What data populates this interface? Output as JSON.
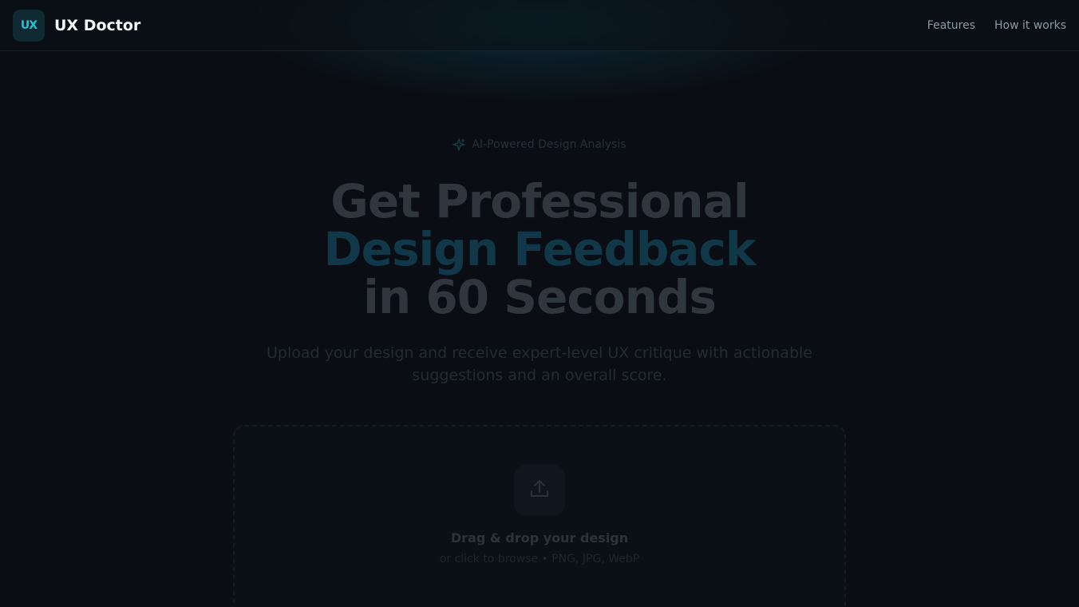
{
  "header": {
    "logo_text": "UX",
    "brand": "UX Doctor",
    "nav": [
      "Features",
      "How it works"
    ]
  },
  "hero": {
    "tag": "AI-Powered Design Analysis",
    "headline_line1": "Get Professional",
    "headline_line2": "Design Feedback",
    "headline_line3": "in 60 Seconds",
    "subtitle": "Upload your design and receive expert-level UX critique with actionable suggestions and an overall score."
  },
  "dropzone": {
    "icon": "upload-icon",
    "title": "Drag & drop your design",
    "subtitle": "or click to browse • PNG, JPG, WebP"
  },
  "colors": {
    "accent": "#22c3d6",
    "background": "#0a0e14"
  }
}
